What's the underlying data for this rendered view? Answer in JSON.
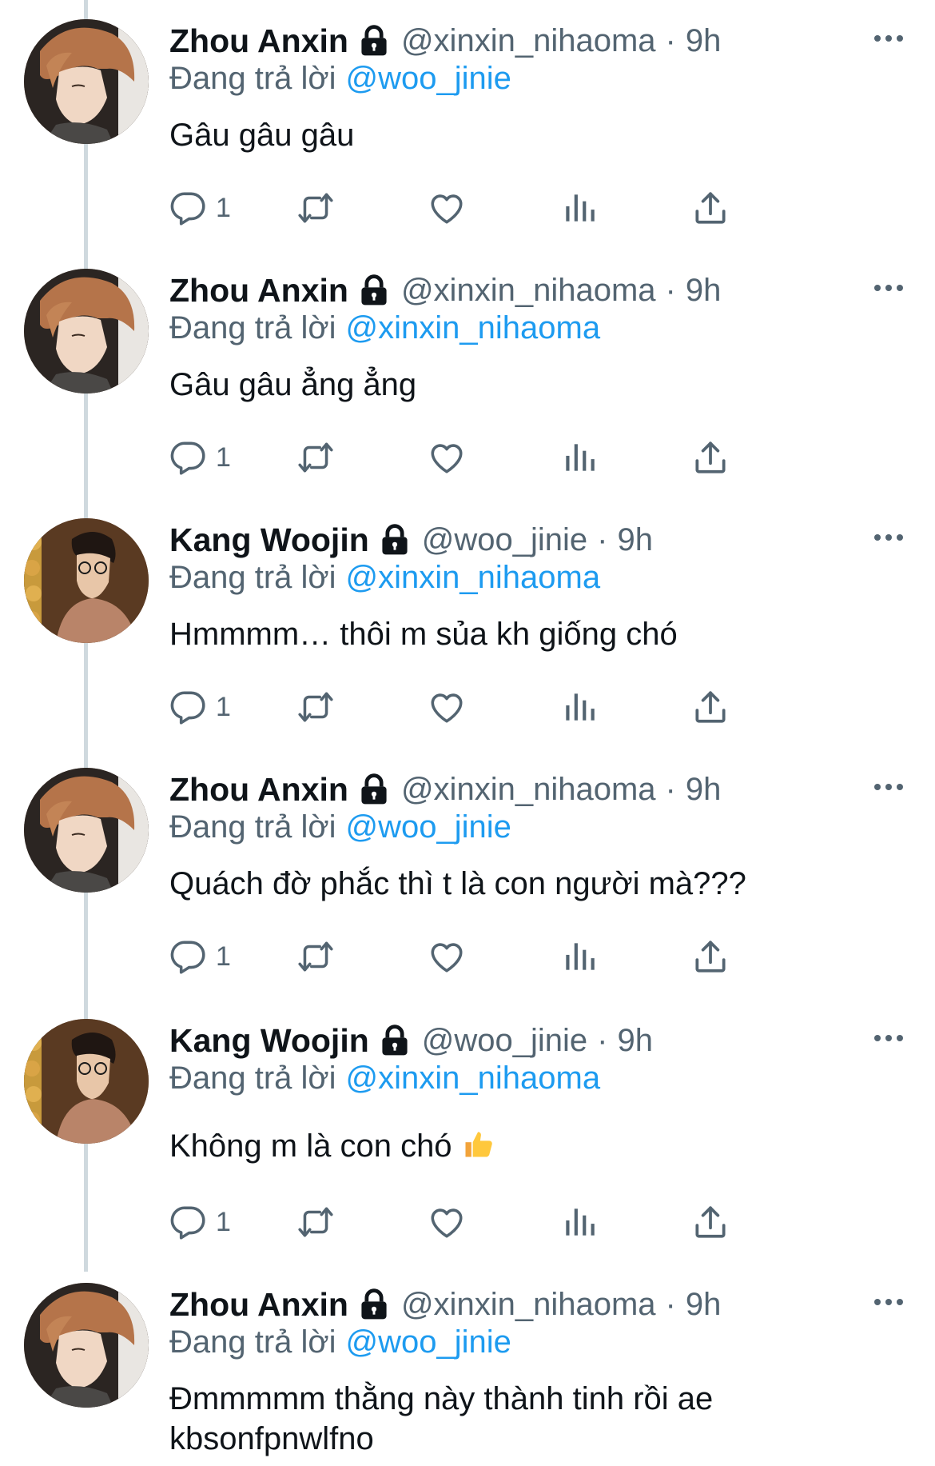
{
  "thread": [
    {
      "avatar": "zhou-anxin-avatar",
      "display_name": "Zhou Anxin",
      "handle": "@xinxin_nihaoma",
      "separator": "·",
      "time": "9h",
      "reply_prefix": "Đang trả lời",
      "reply_to": "@woo_jinie",
      "text": "Gâu gâu gâu",
      "reply_count": "1"
    },
    {
      "avatar": "zhou-anxin-avatar",
      "display_name": "Zhou Anxin",
      "handle": "@xinxin_nihaoma",
      "separator": "·",
      "time": "9h",
      "reply_prefix": "Đang trả lời",
      "reply_to": "@xinxin_nihaoma",
      "text": "Gâu gâu ẳng ẳng",
      "reply_count": "1"
    },
    {
      "avatar": "kang-woojin-avatar",
      "display_name": "Kang Woojin",
      "handle": "@woo_jinie",
      "separator": "·",
      "time": "9h",
      "reply_prefix": "Đang trả lời",
      "reply_to": "@xinxin_nihaoma",
      "text": "Hmmmm… thôi m sủa kh giống chó",
      "reply_count": "1"
    },
    {
      "avatar": "zhou-anxin-avatar",
      "display_name": "Zhou Anxin",
      "handle": "@xinxin_nihaoma",
      "separator": "·",
      "time": "9h",
      "reply_prefix": "Đang trả lời",
      "reply_to": "@woo_jinie",
      "text": "Quách đờ phắc thì t là con người mà???",
      "reply_count": "1"
    },
    {
      "avatar": "kang-woojin-avatar",
      "display_name": "Kang Woojin",
      "handle": "@woo_jinie",
      "separator": "·",
      "time": "9h",
      "reply_prefix": "Đang trả lời",
      "reply_to": "@xinxin_nihaoma",
      "text": "Không m là con chó",
      "emoji": "thumbs-up-emoji",
      "reply_count": "1"
    },
    {
      "avatar": "zhou-anxin-avatar",
      "display_name": "Zhou Anxin",
      "handle": "@xinxin_nihaoma",
      "separator": "·",
      "time": "9h",
      "reply_prefix": "Đang trả lời",
      "reply_to": "@woo_jinie",
      "text_line1": "Đmmmmm thằng này thành tinh rồi ae",
      "text_line2": "kbsonfpnwlfno"
    }
  ],
  "icons": {
    "lock": "lock-icon",
    "more": "more-icon",
    "reply": "reply-icon",
    "retweet": "retweet-icon",
    "like": "heart-icon",
    "analytics": "analytics-icon",
    "share": "share-icon"
  },
  "colors": {
    "text": "#0f1419",
    "secondary": "#536471",
    "accent": "#1d9bf0",
    "thread_line": "#cfd9de",
    "background": "#ffffff"
  }
}
